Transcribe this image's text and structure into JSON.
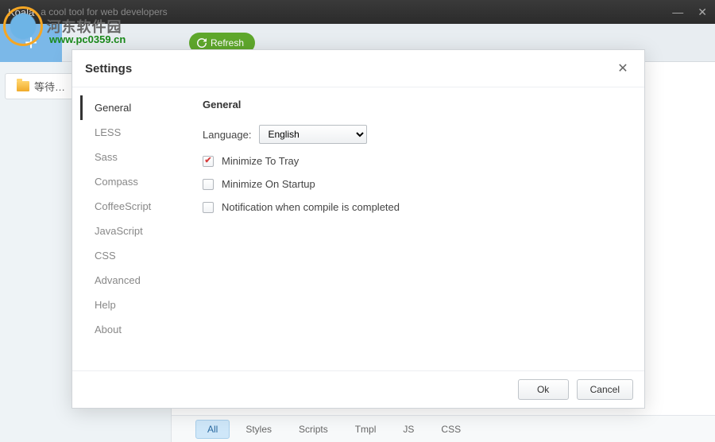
{
  "titlebar": {
    "app_title": "Koala",
    "subtitle": "a cool tool for web developers"
  },
  "watermark": {
    "text": "河东软件园",
    "url": "www.pc0359.cn"
  },
  "toolbar": {
    "refresh_label": "Refresh"
  },
  "sidebar": {
    "items": [
      {
        "label": "等待…"
      }
    ]
  },
  "bottom_tabs": [
    {
      "label": "All",
      "active": true
    },
    {
      "label": "Styles",
      "active": false
    },
    {
      "label": "Scripts",
      "active": false
    },
    {
      "label": "Tmpl",
      "active": false
    },
    {
      "label": "JS",
      "active": false
    },
    {
      "label": "CSS",
      "active": false
    }
  ],
  "modal": {
    "title": "Settings",
    "nav": [
      {
        "label": "General",
        "active": true
      },
      {
        "label": "LESS",
        "active": false
      },
      {
        "label": "Sass",
        "active": false
      },
      {
        "label": "Compass",
        "active": false
      },
      {
        "label": "CoffeeScript",
        "active": false
      },
      {
        "label": "JavaScript",
        "active": false
      },
      {
        "label": "CSS",
        "active": false
      },
      {
        "label": "Advanced",
        "active": false
      },
      {
        "label": "Help",
        "active": false
      },
      {
        "label": "About",
        "active": false
      }
    ],
    "panel": {
      "heading": "General",
      "language_label": "Language:",
      "language_value": "English",
      "language_options": [
        "English"
      ],
      "checkboxes": [
        {
          "label": "Minimize To Tray",
          "checked": true
        },
        {
          "label": "Minimize On Startup",
          "checked": false
        },
        {
          "label": "Notification when compile is completed",
          "checked": false
        }
      ]
    },
    "footer": {
      "ok_label": "Ok",
      "cancel_label": "Cancel"
    }
  }
}
